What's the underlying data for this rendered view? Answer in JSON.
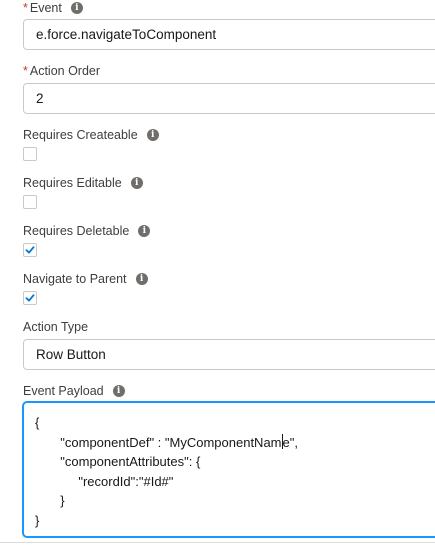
{
  "fields": {
    "event": {
      "label": "Event",
      "value": "e.force.navigateToComponent"
    },
    "action_order": {
      "label": "Action Order",
      "value": "2"
    },
    "requires_createable": {
      "label": "Requires Createable",
      "checked": false
    },
    "requires_editable": {
      "label": "Requires Editable",
      "checked": false
    },
    "requires_deletable": {
      "label": "Requires Deletable",
      "checked": true
    },
    "navigate_to_parent": {
      "label": "Navigate to Parent",
      "checked": true
    },
    "action_type": {
      "label": "Action Type",
      "value": "Row Button"
    },
    "event_payload": {
      "label": "Event Payload",
      "lines": [
        "{",
        "       \"componentDef\" : \"MyComponentNam",
        "e\",",
        "       \"componentAttributes\": {",
        "            \"recordId\":\"#Id#\"",
        "       }",
        "}"
      ]
    }
  },
  "required_marker": "*",
  "colors": {
    "focus_border": "#1b96ff",
    "checkbox_check": "#0176d3",
    "required": "#c23934"
  },
  "icons": {
    "info": "info-icon",
    "check": "checkmark-icon"
  }
}
